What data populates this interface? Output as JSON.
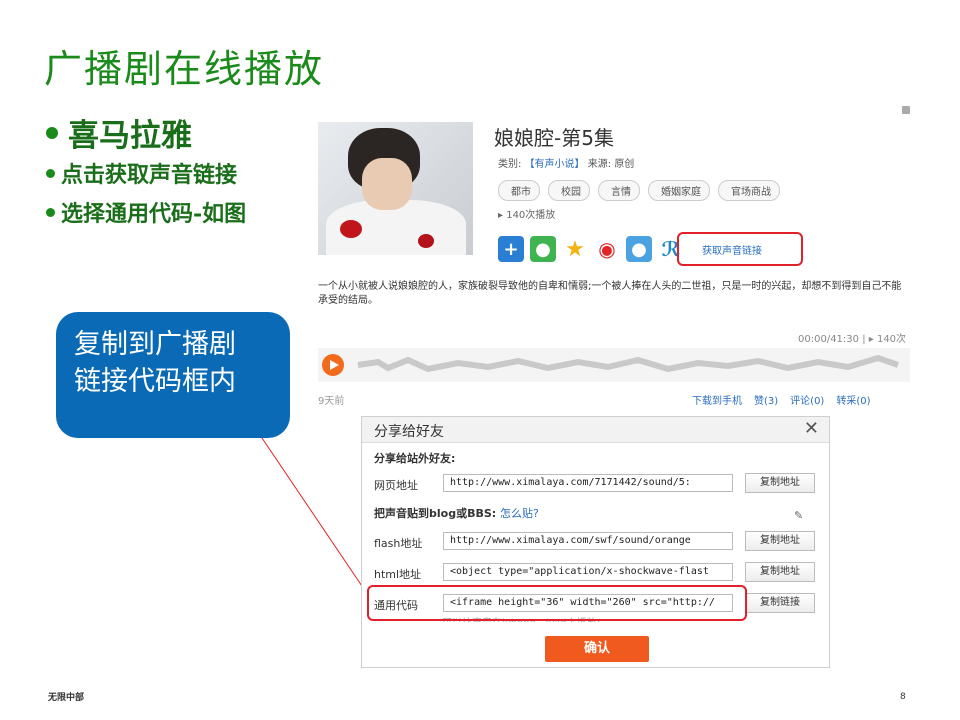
{
  "slide": {
    "title": "广播剧在线播放",
    "bullets": [
      "喜马拉雅",
      "点击获取声音链接",
      "选择通用代码-如图"
    ],
    "callout_line1": "复制到广播剧",
    "callout_line2": "链接代码框内",
    "footer_left": "无限中部",
    "page_number": "8"
  },
  "sound": {
    "title": "娘娘腔-第5集",
    "category_label": "类别:",
    "category": "【有声小说】",
    "source_label": "来源:",
    "source": "原创",
    "tags": [
      "都市",
      "校园",
      "言情",
      "婚姻家庭",
      "官场商战"
    ],
    "plays": "140次播放",
    "get_link": "获取声音链接",
    "description": "一个从小就被人说娘娘腔的人，家族破裂导致他的自卑和懦弱;一个被人捧在人头的二世祖，只是一时的兴起，却想不到得到自己不能承受的结局。",
    "time": "00:00/41:30",
    "play_count": "140次",
    "posted": "9天前",
    "actions": [
      "下载到手机",
      "赞(3)",
      "评论(0)",
      "转采(0)"
    ]
  },
  "icons": {
    "share_icons": [
      "plus-icon",
      "wechat-icon",
      "qzone-icon",
      "weibo-icon",
      "qq-icon",
      "renren-icon"
    ]
  },
  "dialog": {
    "title": "分享给好友",
    "close": "✕",
    "section1": "分享给站外好友:",
    "page_url_label": "网页地址",
    "page_url_value": "http://www.ximalaya.com/7171442/sound/5:",
    "copy_address": "复制地址",
    "section2": "把声音贴到blog或BBS:",
    "how_to": "怎么贴?",
    "flash_label": "flash地址",
    "flash_value": "http://www.ximalaya.com/swf/sound/orange",
    "html_label": "html地址",
    "html_value": "<object type=\"application/x-shockwave-flast",
    "generic_label": "通用代码",
    "generic_value": "<iframe height=\"36\" width=\"260\" src=\"http://",
    "copy_link": "复制链接",
    "hint": "可以让声音在iPhone、iPad上播放!",
    "confirm": "确认"
  },
  "colors": {
    "title_green": "#1a8a1a",
    "callout_blue": "#0a6ab6",
    "highlight_red": "#e0202a",
    "confirm_orange": "#f05a1f"
  }
}
